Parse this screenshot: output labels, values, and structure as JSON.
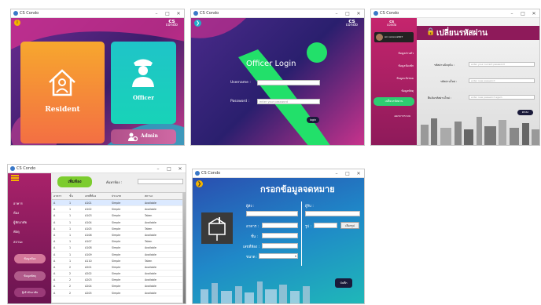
{
  "app_title": "CS Condo",
  "brand_line1": "cs",
  "brand_line2": "condo",
  "window_controls": [
    "–",
    "□",
    "✕"
  ],
  "panel1": {
    "resident_label": "Resident",
    "officer_label": "Officer",
    "admin_label": "Admin"
  },
  "panel2": {
    "heading": "Officer Login",
    "username_label": "Username :",
    "password_label": "Password :",
    "password_placeholder": "enter your password",
    "login_button": "login"
  },
  "panel3": {
    "user_name": "Air xxxxxx2007",
    "heading": "เปลี่ยนรหัสผ่าน",
    "menu": [
      "ข้อมูลส่วนตัว",
      "ข้อมูลห้องพัก",
      "ข้อมูลแจ้งซ่อม",
      "ข้อมูลพัสดุ",
      "เปลี่ยนรหัสผ่าน",
      "ออกจากระบบ"
    ],
    "fields": [
      {
        "label": "รหัสผ่านปัจจุบัน :",
        "placeholder": "enter your current password"
      },
      {
        "label": "รหัสผ่านใหม่ :",
        "placeholder": "enter new password"
      },
      {
        "label": "ยืนยันรหัสผ่านใหม่ :",
        "placeholder": "enter new password again"
      }
    ],
    "confirm_button": "ตกลง"
  },
  "panel4": {
    "add_button": "เพิ่มห้อง",
    "search_label": "ค้นหาห้อง :",
    "menu": [
      "อาคาร",
      "ห้อง",
      "ผู้พักอาศัย",
      "พัสดุ",
      "สถานะ"
    ],
    "side_buttons": [
      "ข้อมูลห้อง",
      "ข้อมูลพัสดุ",
      "ผู้เข้าพักอาศัย"
    ],
    "columns": [
      "อาคาร",
      "ชั้น",
      "เลขที่ห้อง",
      "ประเภท",
      "สถานะ"
    ],
    "rows": [
      [
        "A",
        "1",
        "A101",
        "Simple",
        "Available"
      ],
      [
        "A",
        "1",
        "A102",
        "Simple",
        "Available"
      ],
      [
        "A",
        "1",
        "A103",
        "Simple",
        "Taken"
      ],
      [
        "A",
        "1",
        "A104",
        "Simple",
        "Available"
      ],
      [
        "A",
        "1",
        "A105",
        "Simple",
        "Taken"
      ],
      [
        "A",
        "1",
        "A106",
        "Simple",
        "Available"
      ],
      [
        "A",
        "1",
        "A107",
        "Simple",
        "Taken"
      ],
      [
        "A",
        "1",
        "A108",
        "Simple",
        "Available"
      ],
      [
        "A",
        "1",
        "A109",
        "Simple",
        "Available"
      ],
      [
        "A",
        "1",
        "A110",
        "Simple",
        "Taken"
      ],
      [
        "A",
        "2",
        "A201",
        "Simple",
        "Available"
      ],
      [
        "A",
        "2",
        "A202",
        "Simple",
        "Available"
      ],
      [
        "A",
        "2",
        "A203",
        "Simple",
        "Available"
      ],
      [
        "A",
        "2",
        "A204",
        "Simple",
        "Available"
      ],
      [
        "A",
        "2",
        "A205",
        "Simple",
        "Available"
      ]
    ]
  },
  "panel5": {
    "heading": "กรอกข้อมูลจดหมาย",
    "left_fields": [
      "ผู้ส่ง :",
      "อาคาร :",
      "ชั้น :",
      "เลขที่ห้อง :",
      "ขนาด :"
    ],
    "right_fields": [
      "ผู้รับ :",
      "รูป :"
    ],
    "browse_button": "เลือกรูป",
    "save_button": "บันทึก"
  }
}
